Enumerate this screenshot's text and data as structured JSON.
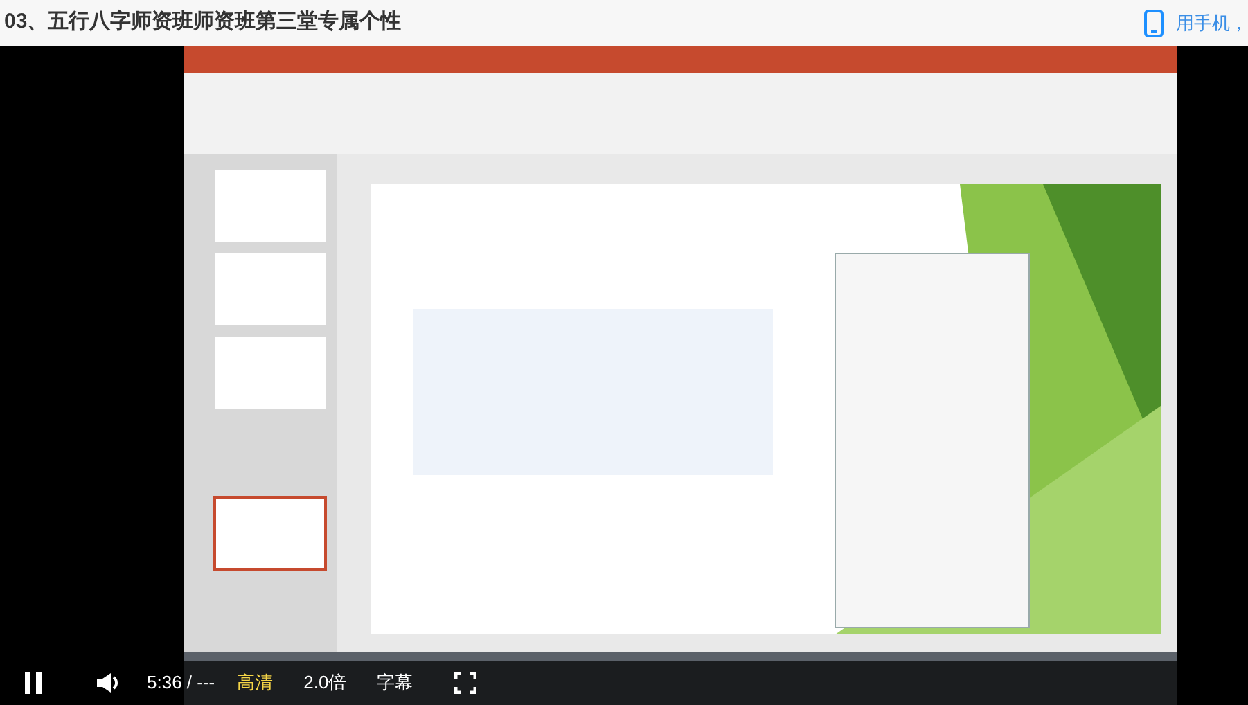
{
  "header": {
    "title": "03、五行八字师资班师资班第三堂专属个性",
    "mobile_link": "用手机，"
  },
  "player": {
    "playing": true,
    "time": "5:36 / ---",
    "text_buttons": [
      {
        "label": "高清",
        "selected": true
      },
      {
        "label": "2.0倍",
        "selected": false
      },
      {
        "label": "字幕",
        "selected": false
      }
    ]
  }
}
